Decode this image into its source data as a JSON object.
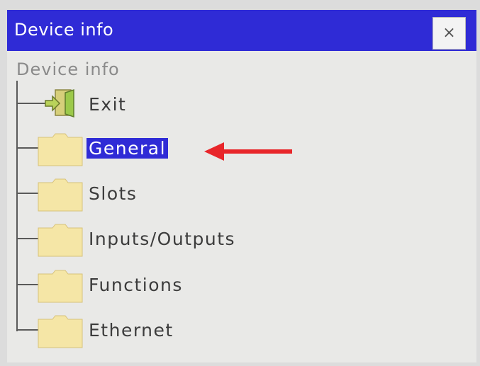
{
  "window": {
    "title": "Device info",
    "close_icon": "close-icon",
    "close_glyph": "×",
    "title_bar_color": "#2f2bd6"
  },
  "tree": {
    "root_label": "Device info",
    "items": [
      {
        "label": "Exit",
        "icon": "exit-icon",
        "selected": false
      },
      {
        "label": "General",
        "icon": "folder-icon",
        "selected": true
      },
      {
        "label": "Slots",
        "icon": "folder-icon",
        "selected": false
      },
      {
        "label": "Inputs/Outputs",
        "icon": "folder-icon",
        "selected": false
      },
      {
        "label": "Functions",
        "icon": "folder-icon",
        "selected": false
      },
      {
        "label": "Ethernet",
        "icon": "folder-icon",
        "selected": false
      }
    ],
    "selection_color": "#2f2bd6"
  },
  "annotation": {
    "icon": "red-arrow-icon",
    "color": "#e8262a"
  }
}
